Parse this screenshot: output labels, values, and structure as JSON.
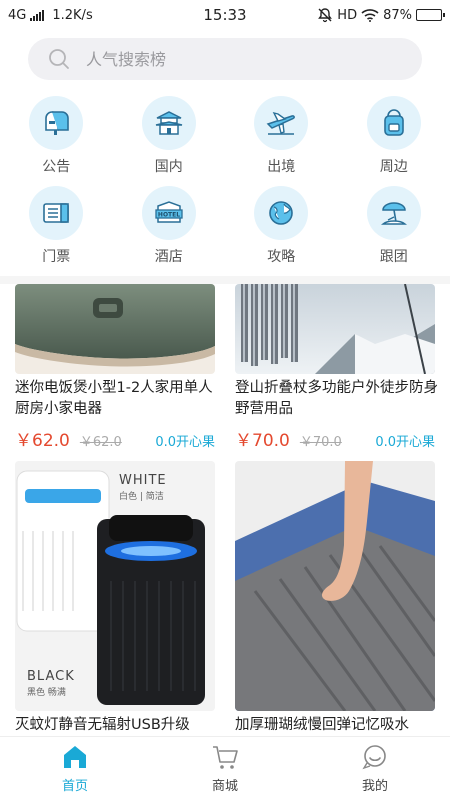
{
  "status_bar": {
    "network": "4G",
    "speed": "1.2K/s",
    "time": "15:33",
    "hd": "HD",
    "battery": "87%",
    "battery_level": 0.87
  },
  "search": {
    "placeholder": "人气搜索榜"
  },
  "categories": [
    {
      "label": "公告",
      "icon": "mailbox-icon"
    },
    {
      "label": "国内",
      "icon": "temple-icon"
    },
    {
      "label": "出境",
      "icon": "airplane-icon"
    },
    {
      "label": "周边",
      "icon": "backpack-icon"
    },
    {
      "label": "门票",
      "icon": "ticket-icon"
    },
    {
      "label": "酒店",
      "icon": "hotel-icon"
    },
    {
      "label": "攻略",
      "icon": "globe-icon"
    },
    {
      "label": "跟团",
      "icon": "beach-umbrella-icon"
    }
  ],
  "products": [
    {
      "title": "迷你电饭煲小型1-2人家用单人厨房小家电器",
      "price": "￥62.0",
      "old_price": "￥62.0",
      "beans": "0.0开心果"
    },
    {
      "title": "登山折叠杖多功能户外徒步防身野营用品",
      "price": "￥70.0",
      "old_price": "￥70.0",
      "beans": "0.0开心果"
    },
    {
      "title": "灭蚊灯静音无辐射USB升级",
      "image_text_1": "WHITE",
      "image_text_2": "白色 | 简洁",
      "image_text_3": "BLACK",
      "image_text_4": "黑色 畅满"
    },
    {
      "title": "加厚珊瑚绒慢回弹记忆吸水"
    }
  ],
  "bottom_nav": [
    {
      "label": "首页",
      "icon": "home-icon",
      "active": true
    },
    {
      "label": "商城",
      "icon": "cart-icon",
      "active": false
    },
    {
      "label": "我的",
      "icon": "chat-bubble-icon",
      "active": false
    }
  ],
  "colors": {
    "accent": "#1aa9d6",
    "price": "#e4492f",
    "icon_bg": "#e3f3fb"
  }
}
